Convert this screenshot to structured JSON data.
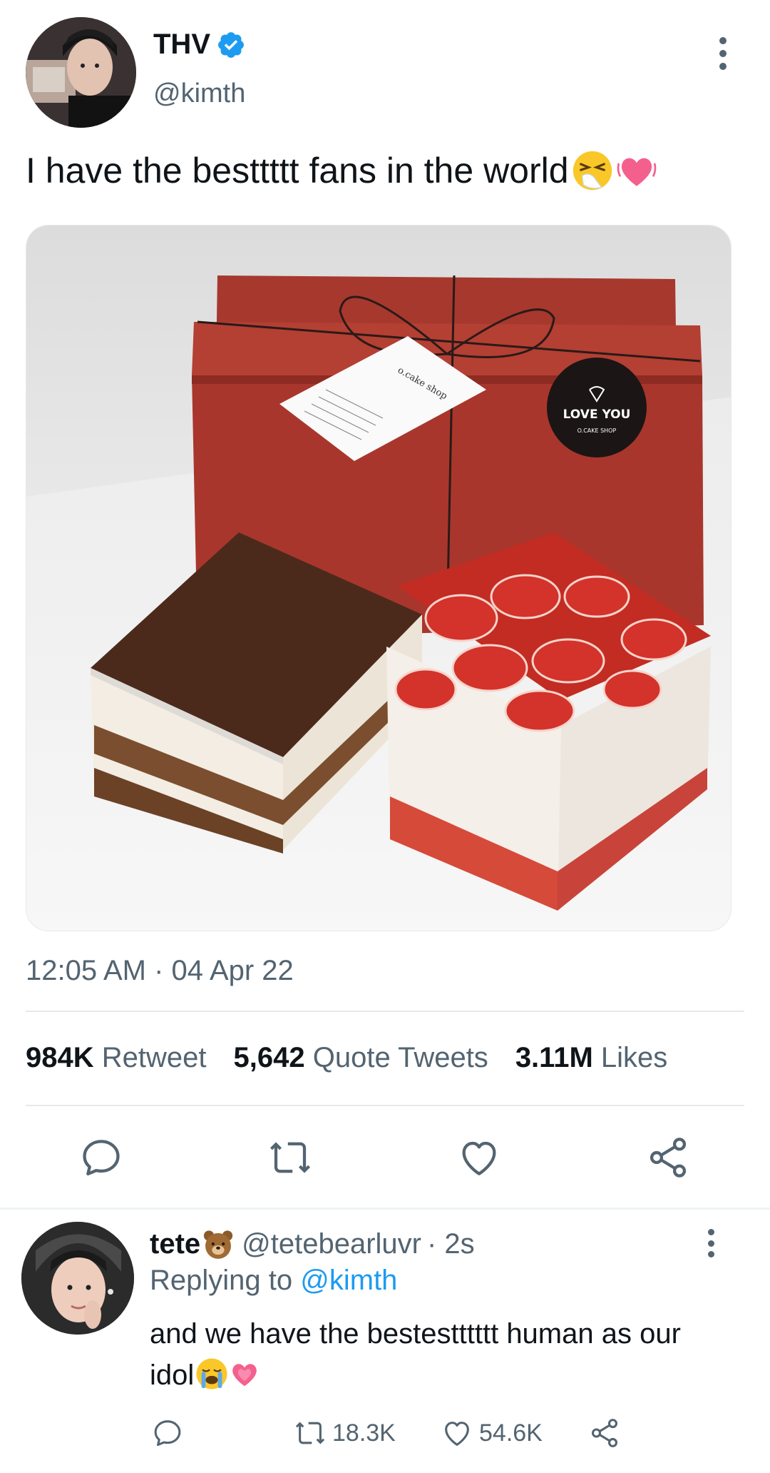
{
  "tweet": {
    "display_name": "THV",
    "handle": "@kimth",
    "text": "I have the besttttt fans in the world",
    "emojis": [
      "sneezing-face-emoji",
      "beating-heart-emoji"
    ],
    "timestamp": "12:05 AM · 04 Apr 22",
    "stats": [
      {
        "value": "984K",
        "label": "Retweet"
      },
      {
        "value": "5,642",
        "label": "Quote Tweets"
      },
      {
        "value": "3.11M",
        "label": "Likes"
      }
    ],
    "actions": [
      "reply-icon",
      "retweet-icon",
      "like-icon",
      "share-icon"
    ],
    "photo": {
      "tag_text": "o.cake shop",
      "sticker_line1": "LOVE YOU",
      "sticker_line2": "O.CAKE SHOP"
    }
  },
  "reply": {
    "display_name": "tete",
    "handle": "@tetebearluvr",
    "time": "· 2s",
    "replying_prefix": "Replying to",
    "replying_to": "@kimth",
    "text": "and we have the bestestttttt human as our idol",
    "counts": {
      "retweets": "18.3K",
      "likes": "54.6K"
    }
  },
  "colors": {
    "accent": "#1d9bf0",
    "secondary_text": "#536471",
    "primary_text": "#0f1419",
    "divider": "#eff3f4"
  }
}
